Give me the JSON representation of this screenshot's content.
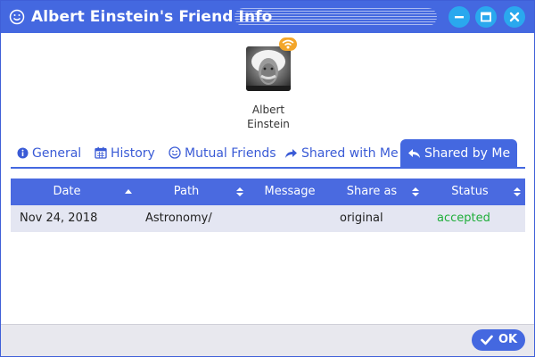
{
  "window": {
    "title": "Albert Einstein's Friend Info",
    "controls": [
      "minimize",
      "maximize",
      "close"
    ]
  },
  "profile": {
    "first_name": "Albert",
    "last_name": "Einstein",
    "status_icon": "wifi-icon"
  },
  "tabs": [
    {
      "label": "General",
      "icon": "info-icon",
      "active": false
    },
    {
      "label": "History",
      "icon": "calendar-icon",
      "active": false
    },
    {
      "label": "Mutual Friends",
      "icon": "smiley-icon",
      "active": false
    },
    {
      "label": "Shared with Me",
      "icon": "share-arrow-icon",
      "active": false
    },
    {
      "label": "Shared by Me",
      "icon": "reply-arrow-icon",
      "active": true
    }
  ],
  "table": {
    "columns": [
      "Date",
      "Path",
      "Message",
      "Share as",
      "Status"
    ],
    "sorted_column": "Date",
    "sort_direction": "ascending",
    "rows": [
      {
        "date": "Nov 24, 2018",
        "path": "Astronomy/",
        "message": "",
        "share_as": "original",
        "status": "accepted"
      }
    ]
  },
  "footer": {
    "ok_label": "OK"
  },
  "colors": {
    "accent": "#4468e0",
    "window_button": "#2aa8ee",
    "status_accepted": "#1fae3a",
    "badge": "#f3a62a"
  }
}
